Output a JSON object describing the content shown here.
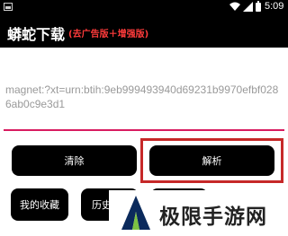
{
  "status_bar": {
    "time": "5:09"
  },
  "app_bar": {
    "title": "蟒蛇下载",
    "subtitle": "(去广告版＋增强版)"
  },
  "input": {
    "value": "magnet:?xt=urn:btih:9eb999493940d69231b9970efbf0286ab0c9e3d1"
  },
  "buttons": {
    "clear": "清除",
    "parse": "解析",
    "favorites": "我的收藏",
    "history": "历史"
  },
  "watermark": {
    "text": "极限手游网"
  },
  "colors": {
    "accent_underline": "#d81b60",
    "highlight_box": "#c62828",
    "subtitle": "#ff3b3b"
  }
}
